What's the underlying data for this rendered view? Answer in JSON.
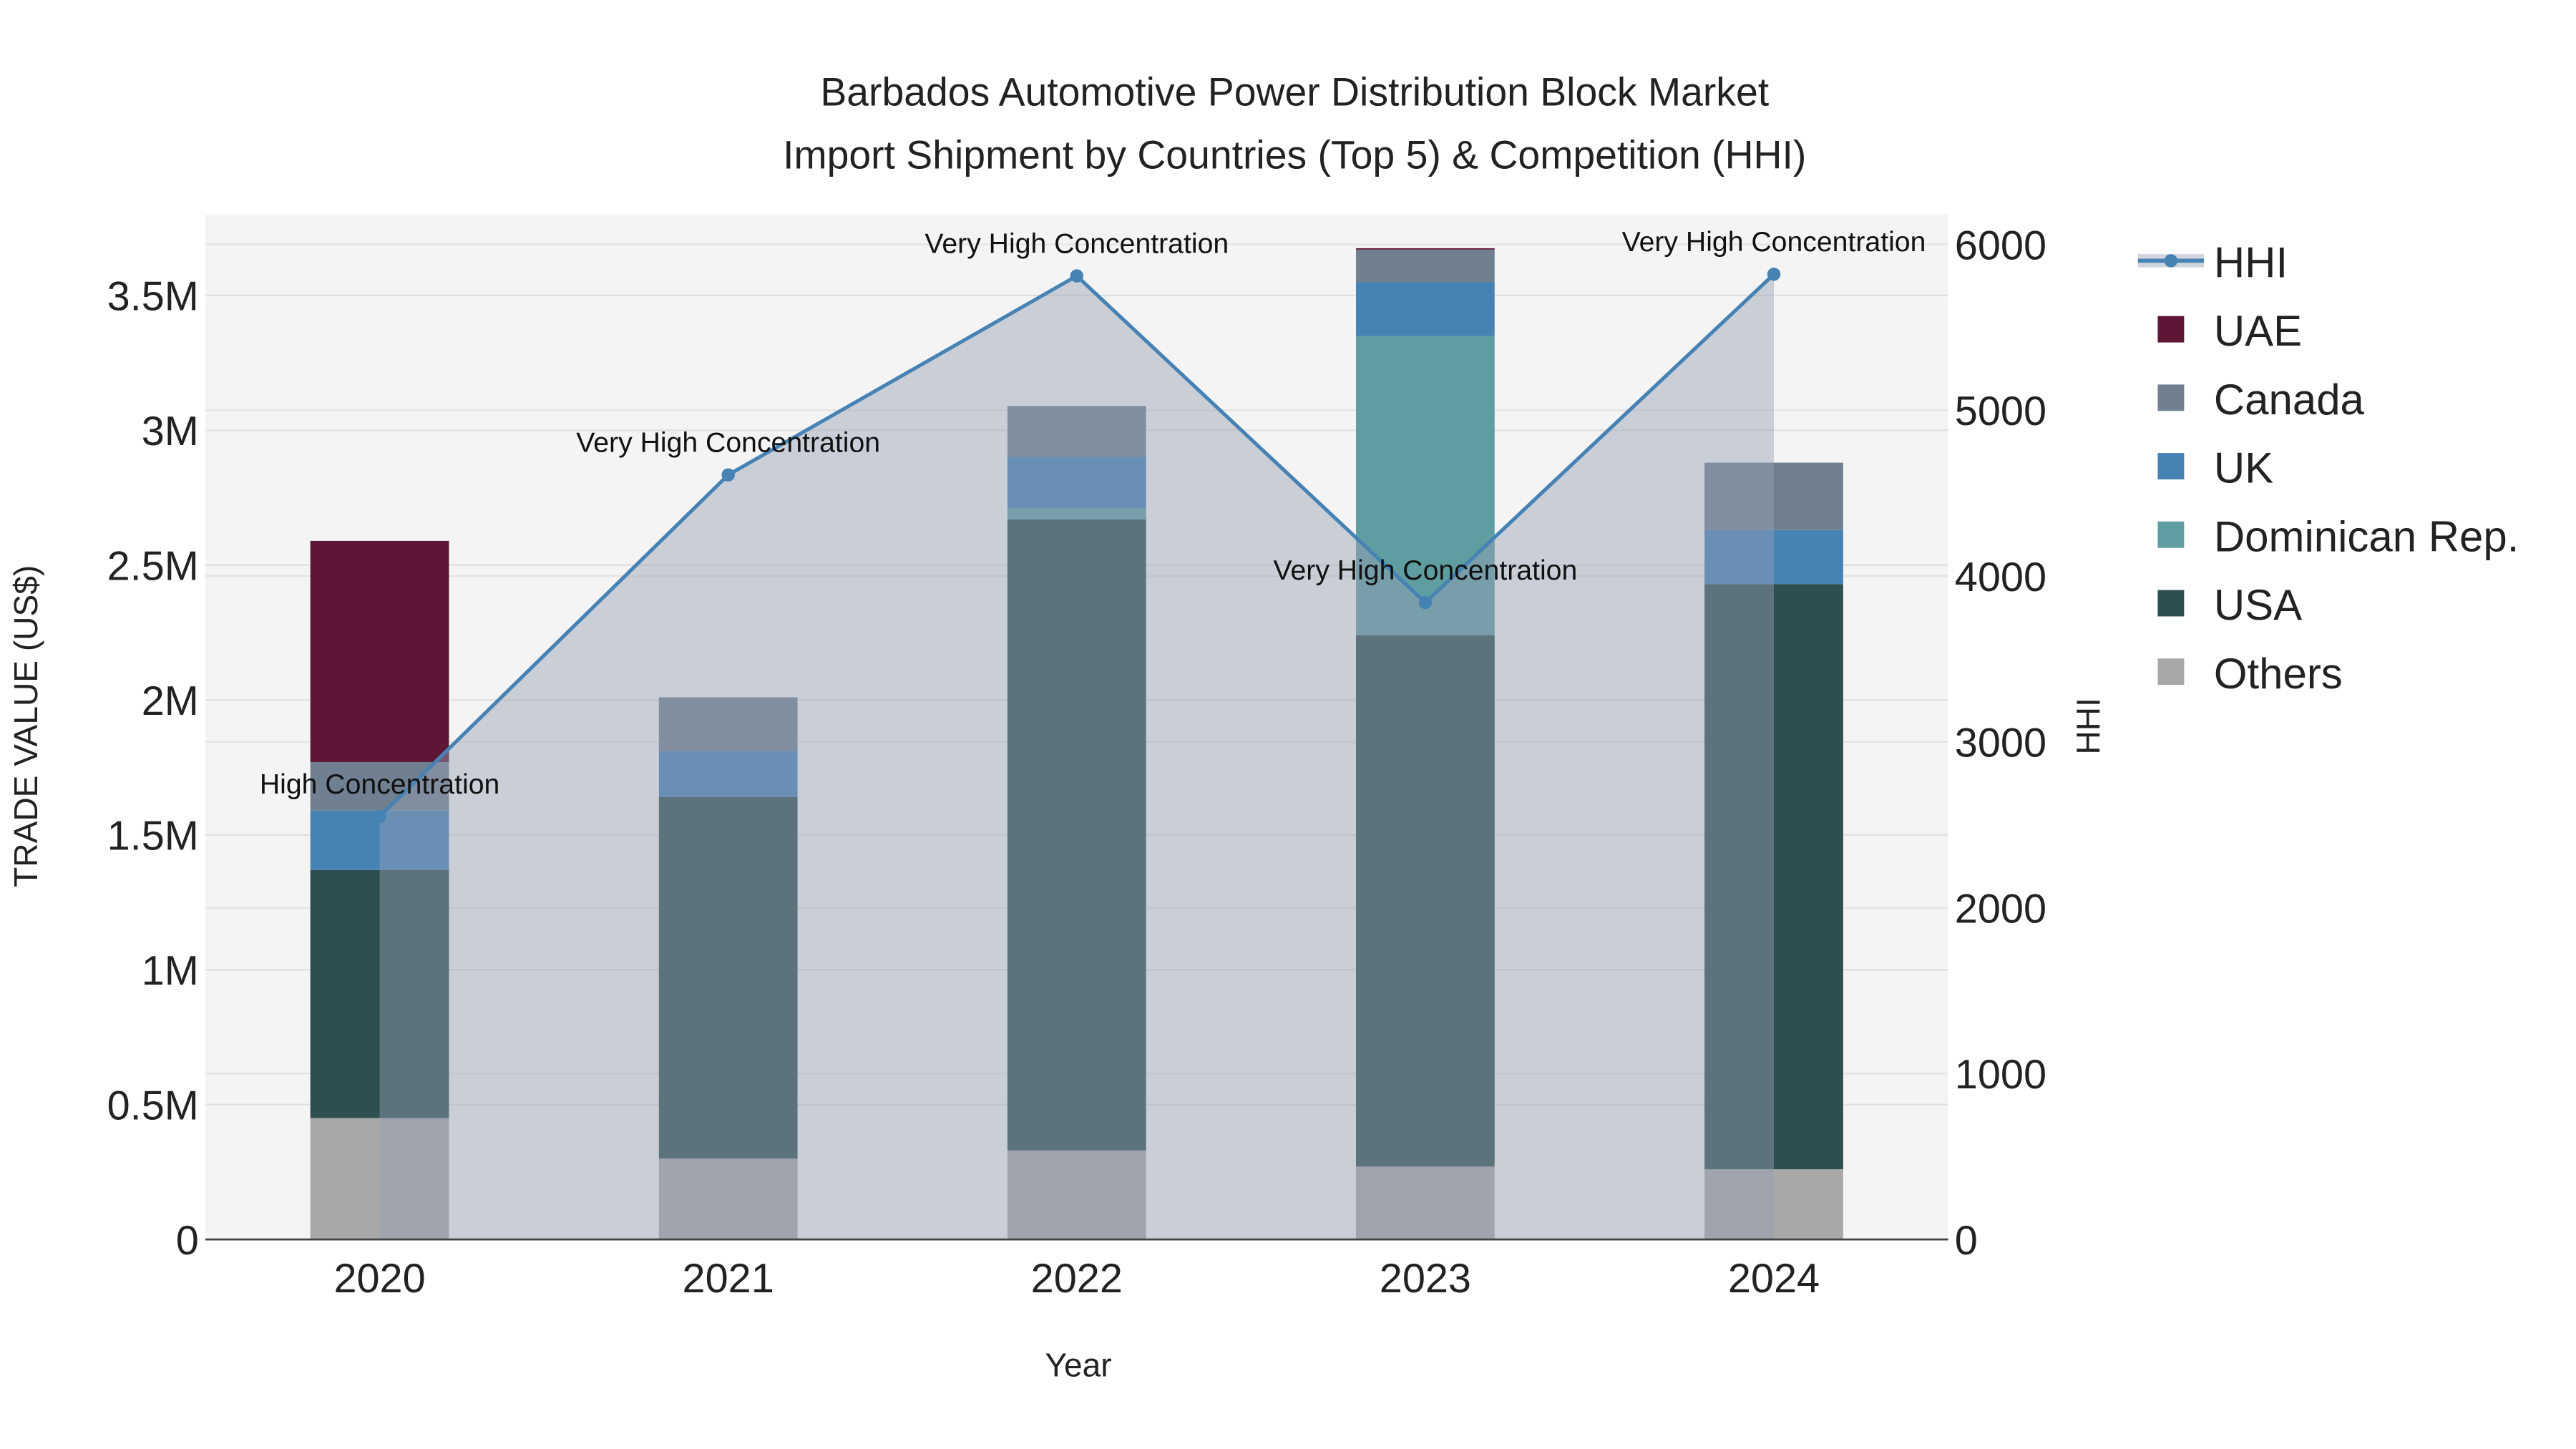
{
  "chart_data": {
    "type": "bar",
    "title_line1": "Barbados Automotive Power Distribution Block Market",
    "title_line2": "Import Shipment by Countries (Top 5) & Competition (HHI)",
    "xlabel": "Year",
    "ylabel": "TRADE VALUE (US$)",
    "y2label": "HHI",
    "categories": [
      "2020",
      "2021",
      "2022",
      "2023",
      "2024"
    ],
    "ylim": [
      0,
      3800000
    ],
    "y_ticks": [
      {
        "v": 0,
        "label": "0"
      },
      {
        "v": 500000,
        "label": "0.5M"
      },
      {
        "v": 1000000,
        "label": "1M"
      },
      {
        "v": 1500000,
        "label": "1.5M"
      },
      {
        "v": 2000000,
        "label": "2M"
      },
      {
        "v": 2500000,
        "label": "2.5M"
      },
      {
        "v": 3000000,
        "label": "3M"
      },
      {
        "v": 3500000,
        "label": "3.5M"
      }
    ],
    "y2lim": [
      0,
      6180
    ],
    "y2_ticks": [
      {
        "v": 0,
        "label": "0"
      },
      {
        "v": 1000,
        "label": "1000"
      },
      {
        "v": 2000,
        "label": "2000"
      },
      {
        "v": 3000,
        "label": "3000"
      },
      {
        "v": 4000,
        "label": "4000"
      },
      {
        "v": 5000,
        "label": "5000"
      },
      {
        "v": 6000,
        "label": "6000"
      }
    ],
    "series": [
      {
        "name": "Others",
        "color": "#a8a8a8",
        "values": [
          450000,
          300000,
          330000,
          270000,
          260000
        ]
      },
      {
        "name": "USA",
        "color": "#2e4f4f",
        "values": [
          920000,
          1340000,
          2340000,
          1970000,
          2170000
        ]
      },
      {
        "name": "Dominican Rep.",
        "color": "#5f9ea0",
        "values": [
          0,
          0,
          40000,
          1110000,
          0
        ]
      },
      {
        "name": "UK",
        "color": "#4682b4",
        "values": [
          220000,
          170000,
          190000,
          200000,
          200000
        ]
      },
      {
        "name": "Canada",
        "color": "#708090",
        "values": [
          180000,
          200000,
          190000,
          120000,
          250000
        ]
      },
      {
        "name": "UAE",
        "color": "#5e1636",
        "values": [
          820000,
          0,
          0,
          5000,
          0
        ]
      }
    ],
    "hhi": {
      "name": "HHI",
      "color": "#4682b4",
      "values": [
        2550,
        4610,
        5810,
        3840,
        5820
      ],
      "annotations": [
        "High Concentration",
        "Very High Concentration",
        "Very High Concentration",
        "Very High Concentration",
        "Very High Concentration"
      ]
    },
    "legend_order": [
      "HHI",
      "UAE",
      "Canada",
      "UK",
      "Dominican Rep.",
      "USA",
      "Others"
    ],
    "legend_position": "right",
    "grid": true
  }
}
